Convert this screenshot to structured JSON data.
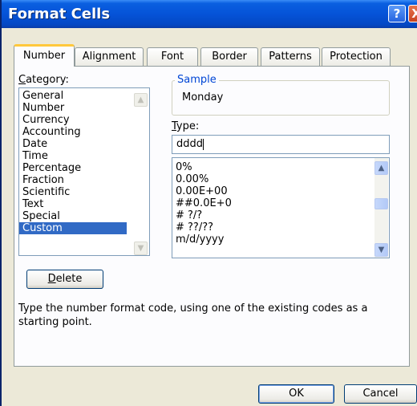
{
  "window": {
    "title": "Format Cells",
    "help_glyph": "?",
    "close_glyph": "X"
  },
  "tabs": [
    {
      "label": "Number",
      "active": true
    },
    {
      "label": "Alignment"
    },
    {
      "label": "Font"
    },
    {
      "label": "Border"
    },
    {
      "label": "Patterns"
    },
    {
      "label": "Protection"
    }
  ],
  "category": {
    "label_accel": "C",
    "label_rest": "ategory:",
    "items": [
      "General",
      "Number",
      "Currency",
      "Accounting",
      "Date",
      "Time",
      "Percentage",
      "Fraction",
      "Scientific",
      "Text",
      "Special",
      "Custom"
    ],
    "selected": "Custom"
  },
  "sample": {
    "legend": "Sample",
    "value": "Monday"
  },
  "type": {
    "label_accel": "T",
    "label_rest": "ype:",
    "value": "dddd",
    "formats": [
      "0%",
      "0.00%",
      "0.00E+00",
      "##0.0E+0",
      "# ?/?",
      "# ??/??",
      "m/d/yyyy"
    ]
  },
  "buttons": {
    "delete_accel": "D",
    "delete_rest": "elete",
    "ok": "OK",
    "cancel": "Cancel"
  },
  "description": "Type the number format code, using one of the existing codes as a starting point.",
  "colors": {
    "titlebar": "#0553d8",
    "selection": "#316ac5",
    "active_tab_accent": "#ffc83c",
    "dialog_bg": "#ece9d8"
  },
  "icons": {
    "scroll_up": "▲",
    "scroll_down": "▼"
  }
}
